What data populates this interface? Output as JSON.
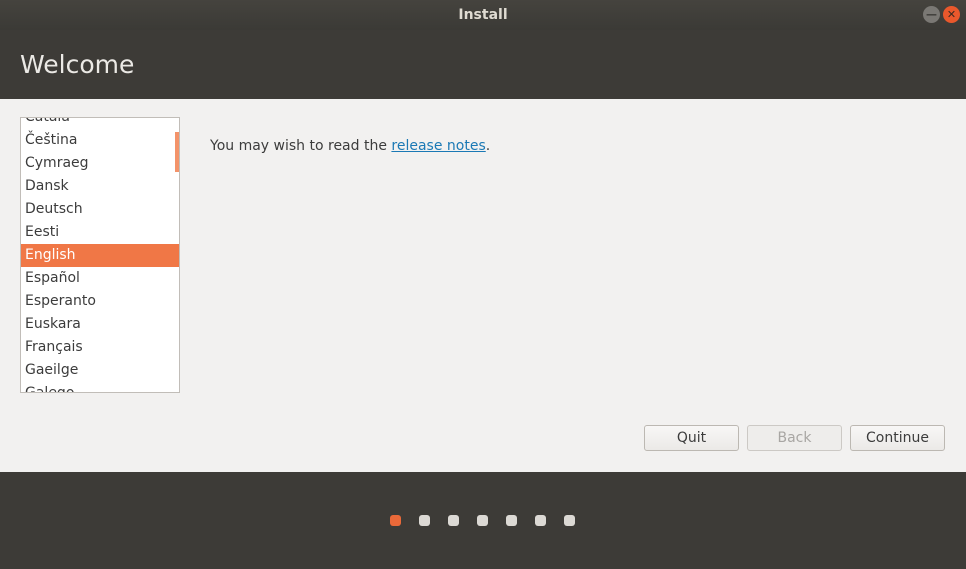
{
  "window": {
    "title": "Install"
  },
  "header": {
    "title": "Welcome"
  },
  "languages": {
    "items": [
      "Català",
      "Čeština",
      "Cymraeg",
      "Dansk",
      "Deutsch",
      "Eesti",
      "English",
      "Español",
      "Esperanto",
      "Euskara",
      "Français",
      "Gaeilge",
      "Galego"
    ],
    "selected": "English"
  },
  "message": {
    "prefix": "You may wish to read the ",
    "link": "release notes",
    "suffix": "."
  },
  "buttons": {
    "quit": "Quit",
    "back": "Back",
    "continue": "Continue"
  },
  "progress": {
    "steps": 7,
    "current": 1
  },
  "colors": {
    "accent": "#f07746",
    "header": "#3d3b37"
  }
}
